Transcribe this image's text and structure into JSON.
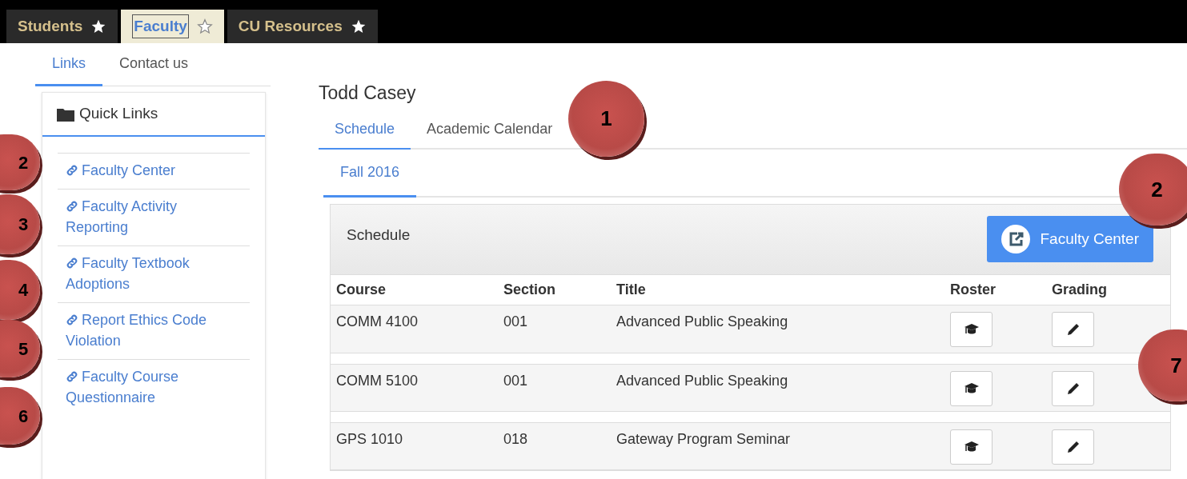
{
  "top_tabs": [
    {
      "label": "Students",
      "selected": false,
      "favorite": true
    },
    {
      "label": "Faculty",
      "selected": true,
      "favorite": false
    },
    {
      "label": "CU Resources",
      "selected": false,
      "favorite": true
    }
  ],
  "side_tabs": [
    {
      "label": "Links",
      "selected": true
    },
    {
      "label": "Contact us",
      "selected": false
    }
  ],
  "quick_links": {
    "title": "Quick Links",
    "items": [
      "Faculty Center",
      "Faculty Activity Reporting",
      "Faculty Textbook Adoptions",
      "Report Ethics Code Violation",
      "Faculty Course Questionnaire"
    ]
  },
  "user_name": "Todd Casey",
  "main_tabs": [
    {
      "label": "Schedule",
      "selected": true
    },
    {
      "label": "Academic Calendar",
      "selected": false
    }
  ],
  "term_tabs": [
    {
      "label": "Fall 2016",
      "selected": true
    }
  ],
  "schedule": {
    "title": "Schedule",
    "button": "Faculty Center",
    "columns": [
      "Course",
      "Section",
      "Title",
      "Roster",
      "Grading"
    ],
    "rows": [
      {
        "course": "COMM 4100",
        "section": "001",
        "title": "Advanced Public Speaking"
      },
      {
        "course": "COMM 5100",
        "section": "001",
        "title": "Advanced Public Speaking"
      },
      {
        "course": "GPS 1010",
        "section": "018",
        "title": "Gateway Program Seminar"
      }
    ]
  },
  "callouts": [
    "1",
    "2",
    "3",
    "4",
    "5",
    "6",
    "2",
    "7"
  ]
}
